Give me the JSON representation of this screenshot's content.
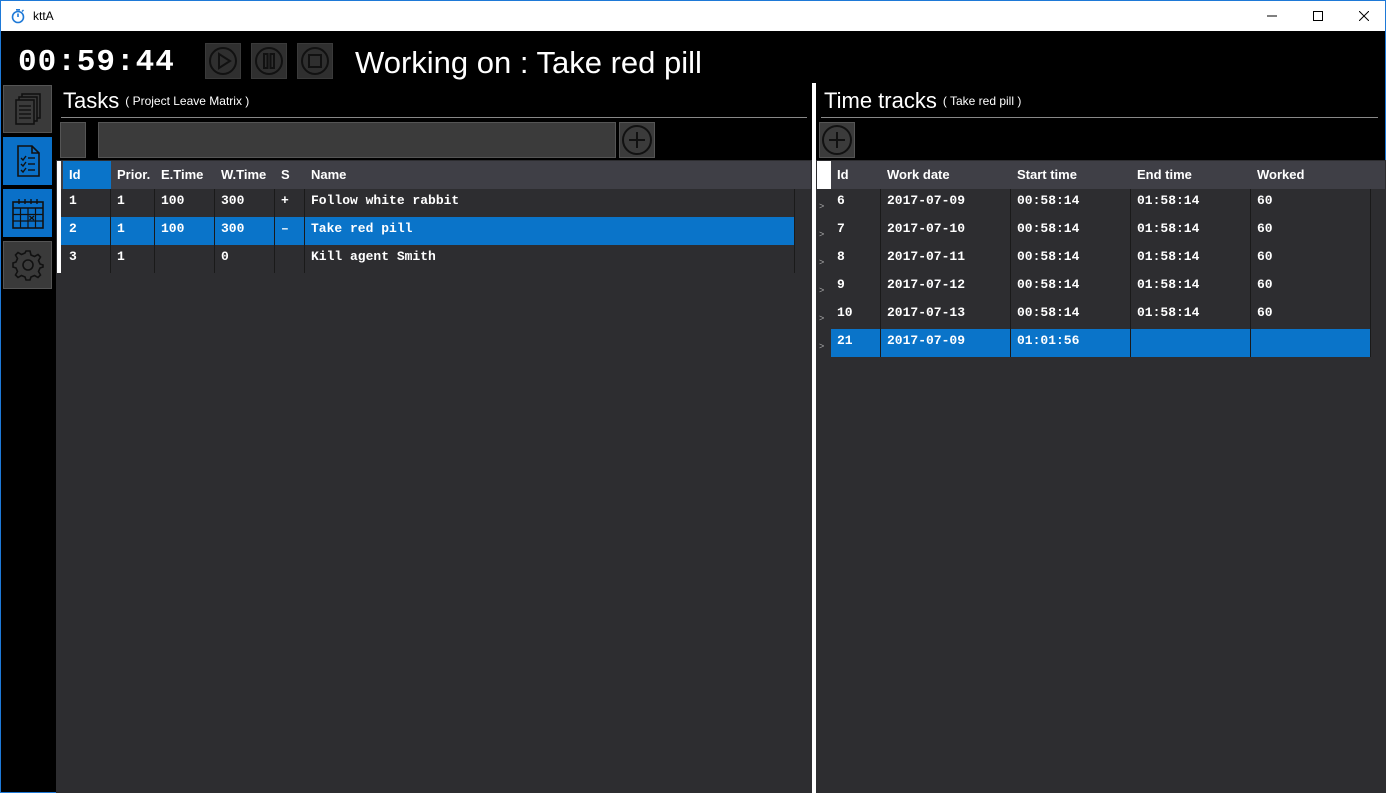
{
  "window": {
    "title": "kttA",
    "app_icon": "stopwatch-icon",
    "accent": "#1e79d7"
  },
  "header": {
    "timer": "00:59:44",
    "working_on": "Working on : Take red pill",
    "controls": [
      "play-icon",
      "pause-icon",
      "stop-icon"
    ]
  },
  "nav": [
    "projects-icon",
    "tasks-icon",
    "calendar-icon",
    "settings-icon"
  ],
  "tasks": {
    "title": "Tasks",
    "subtitle": "( Project Leave Matrix )",
    "filter_value": "",
    "columns": [
      "Id",
      "Prior.",
      "E.Time",
      "W.Time",
      "S",
      "Name"
    ],
    "rows": [
      {
        "id": "1",
        "prior": "1",
        "etime": "100",
        "wtime": "300",
        "s": "+",
        "name": "Follow white rabbit"
      },
      {
        "id": "2",
        "prior": "1",
        "etime": "100",
        "wtime": "300",
        "s": "–",
        "name": "Take red pill"
      },
      {
        "id": "3",
        "prior": "1",
        "etime": "",
        "wtime": "0",
        "s": "",
        "name": "Kill agent Smith"
      }
    ],
    "selected_index": 1
  },
  "tracks": {
    "title": "Time tracks",
    "subtitle": "( Take red pill )",
    "columns": [
      "Id",
      "Work date",
      "Start time",
      "End time",
      "Worked"
    ],
    "row_marker": ">",
    "rows": [
      {
        "id": "6",
        "date": "2017-07-09",
        "start": "00:58:14",
        "end": "01:58:14",
        "worked": "60"
      },
      {
        "id": "7",
        "date": "2017-07-10",
        "start": "00:58:14",
        "end": "01:58:14",
        "worked": "60"
      },
      {
        "id": "8",
        "date": "2017-07-11",
        "start": "00:58:14",
        "end": "01:58:14",
        "worked": "60"
      },
      {
        "id": "9",
        "date": "2017-07-12",
        "start": "00:58:14",
        "end": "01:58:14",
        "worked": "60"
      },
      {
        "id": "10",
        "date": "2017-07-13",
        "start": "00:58:14",
        "end": "01:58:14",
        "worked": "60"
      },
      {
        "id": "21",
        "date": "2017-07-09",
        "start": "01:01:56",
        "end": "",
        "worked": ""
      }
    ],
    "selected_index": 5
  },
  "colors": {
    "selection": "#0a74c9",
    "panel": "#2d2d30",
    "header": "#3f3f46"
  }
}
